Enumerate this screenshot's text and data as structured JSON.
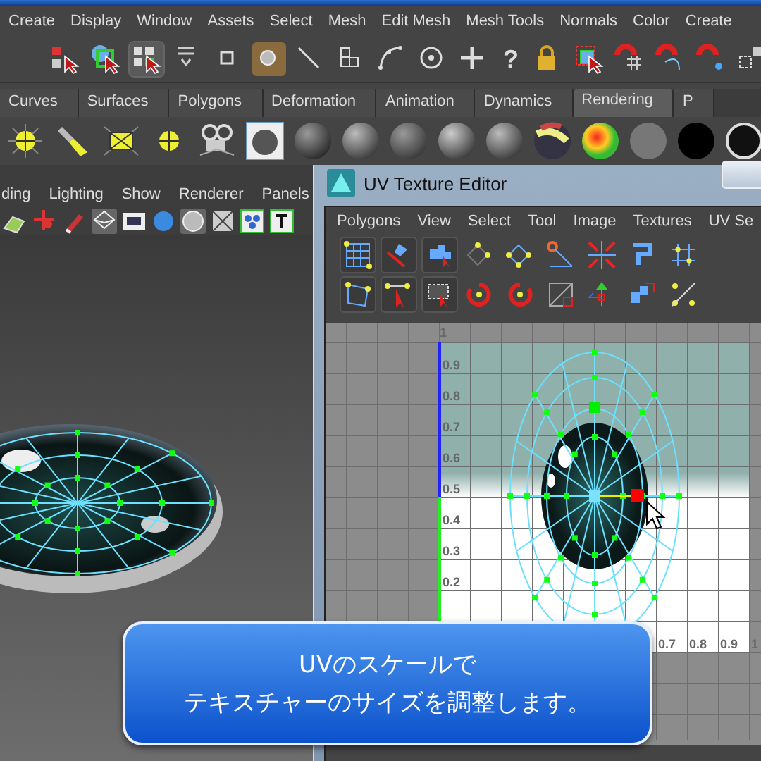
{
  "menu_bar": {
    "items": [
      "Create",
      "Display",
      "Window",
      "Assets",
      "Select",
      "Mesh",
      "Edit Mesh",
      "Mesh Tools",
      "Normals",
      "Color",
      "Create"
    ]
  },
  "toolbar": {
    "help_glyph": "?"
  },
  "shelf_tabs": [
    {
      "label": "Curves",
      "selected": false
    },
    {
      "label": "Surfaces",
      "selected": false
    },
    {
      "label": "Polygons",
      "selected": false
    },
    {
      "label": "Deformation",
      "selected": false
    },
    {
      "label": "Animation",
      "selected": false
    },
    {
      "label": "Dynamics",
      "selected": false
    },
    {
      "label": "Rendering",
      "selected": true
    },
    {
      "label": "P",
      "selected": false
    }
  ],
  "viewport": {
    "menu": [
      "ding",
      "Lighting",
      "Show",
      "Renderer",
      "Panels"
    ]
  },
  "uv_editor": {
    "title": "UV Texture Editor",
    "menu": [
      "Polygons",
      "View",
      "Select",
      "Tool",
      "Image",
      "Textures",
      "UV Se"
    ],
    "v_labels": [
      "1",
      "0.9",
      "0.8",
      "0.7",
      "0.6",
      "0.5",
      "0.4",
      "0.3",
      "0.2"
    ],
    "u_labels": [
      "0.7",
      "0.8",
      "0.9",
      "1"
    ]
  },
  "callout": {
    "lines": [
      "UVのスケールで",
      "テキスチャーのサイズを調整します。"
    ]
  }
}
